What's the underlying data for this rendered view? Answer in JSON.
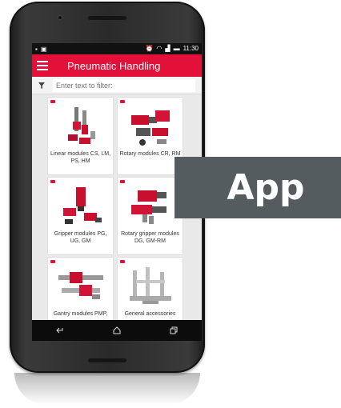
{
  "status_bar": {
    "time": "11:30"
  },
  "app_bar": {
    "title": "Pneumatic Handling"
  },
  "filter": {
    "placeholder": "Enter text to filter:"
  },
  "cards": [
    {
      "label": "Linear modules CS, LM, PS, HM"
    },
    {
      "label": "Rotary modules CR, RM"
    },
    {
      "label": "Gripper modules PG, UG, GM"
    },
    {
      "label": "Rotary gripper modules DG, GM-RM"
    },
    {
      "label": "Gantry modules PMP,"
    },
    {
      "label": "General accessories"
    }
  ],
  "badge": {
    "label": "App"
  },
  "colors": {
    "accent": "#e3103a",
    "badge_bg": "#555c5f"
  }
}
